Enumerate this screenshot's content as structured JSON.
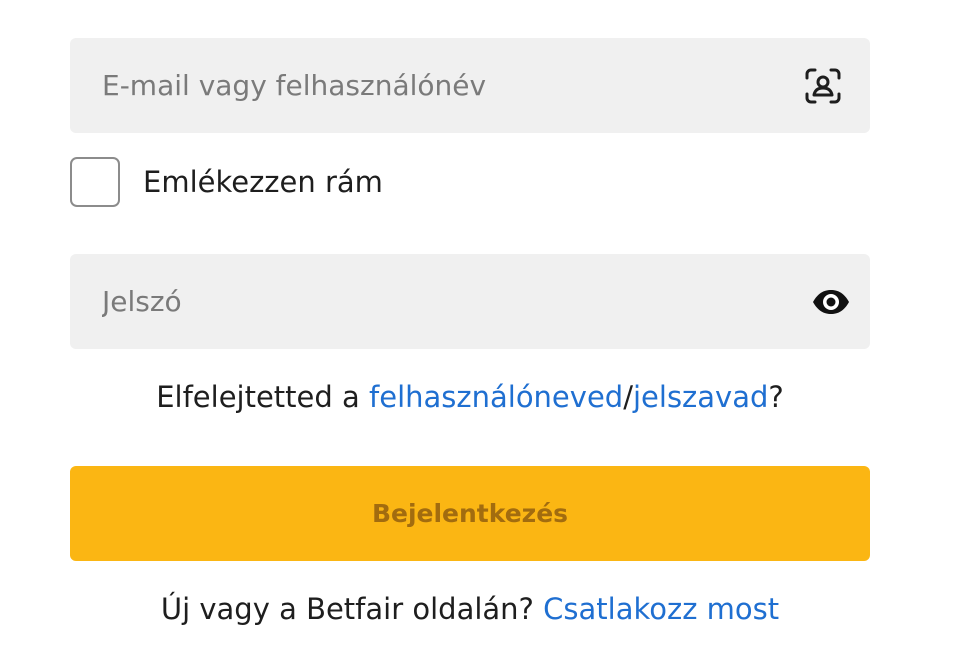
{
  "login_form": {
    "username": {
      "placeholder": "E-mail vagy felhasználónév",
      "value": "",
      "icon": "user-scan-icon"
    },
    "remember_me": {
      "label": "Emlékezzen rám",
      "checked": false
    },
    "password": {
      "placeholder": "Jelszó",
      "value": "",
      "icon": "eye-icon"
    },
    "forgot": {
      "prefix": "Elfelejtetted a ",
      "username_link": "felhasználóneved",
      "separator": "/",
      "password_link": "jelszavad",
      "suffix": "?"
    },
    "submit_label": "Bejelentkezés",
    "join": {
      "prefix": "Új vagy a Betfair oldalán? ",
      "link": "Csatlakozz most"
    }
  },
  "colors": {
    "field_background": "#f0f0f0",
    "link": "#1f6fd1",
    "button_background": "#fbb613",
    "button_text": "#a26c0f"
  }
}
